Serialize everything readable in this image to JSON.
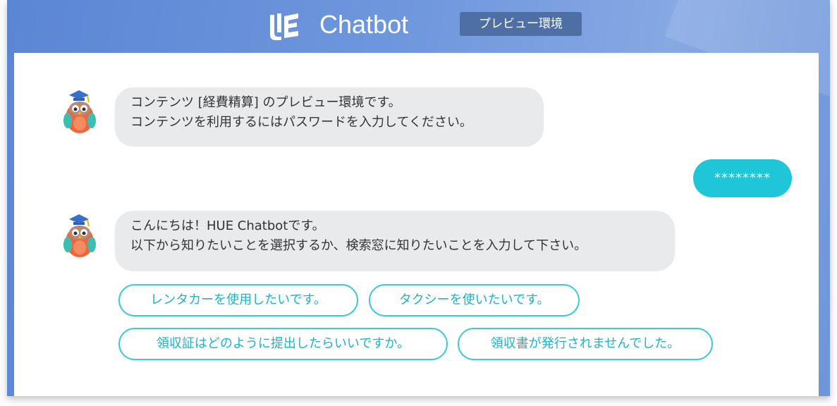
{
  "header": {
    "logo_icon": "hue-logo-icon",
    "title": "Chatbot",
    "env_badge": "プレビュー環境"
  },
  "colors": {
    "header_bg": "#6a92da",
    "badge_bg": "#4e6fa3",
    "bot_bubble": "#e9eaec",
    "user_bubble": "#1fc6d8",
    "chip_border": "#3cc9d8",
    "chip_text": "#1eb4c8"
  },
  "messages": [
    {
      "from": "bot",
      "avatar_icon": "owl-avatar-icon",
      "lines": [
        "コンテンツ [経費精算] のプレビュー環境です。",
        "コンテンツを利用するにはパスワードを入力してください。"
      ]
    },
    {
      "from": "user",
      "text": "********"
    },
    {
      "from": "bot",
      "avatar_icon": "owl-avatar-icon",
      "lines": [
        "こんにちは！HUE Chatbotです。",
        "以下から知りたいことを選択するか、検索窓に知りたいことを入力して下さい。"
      ]
    }
  ],
  "suggestions": [
    "レンタカーを使用したいです。",
    "タクシーを使いたいです。",
    "領収証はどのように提出したらいいですか。",
    "領収書が発行されませんでした。"
  ]
}
